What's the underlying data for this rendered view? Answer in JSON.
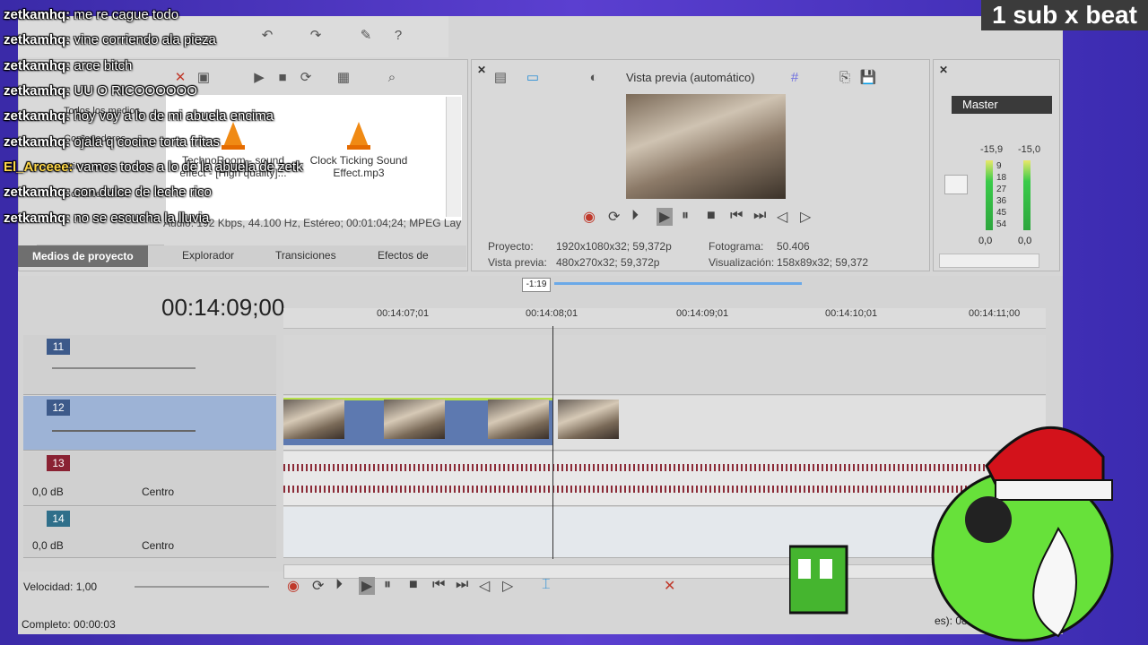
{
  "overlay": {
    "badge": "1 sub x beat",
    "chat": [
      {
        "user": "zetkamhq:",
        "msg": "me re cague todo"
      },
      {
        "user": "zetkamhq:",
        "msg": "vine corriendo ala pieza"
      },
      {
        "user": "zetkamhq:",
        "msg": "arce bitch"
      },
      {
        "user": "zetkamhq:",
        "msg": "UU O RICOOOOOO"
      },
      {
        "user": "zetkamhq:",
        "msg": "hoy voy a lo de mi abuela encima"
      },
      {
        "user": "zetkamhq:",
        "msg": "ojala q cocine torta fritas"
      },
      {
        "user": "El_Arceee:",
        "msg": "vamos todos a lo de la abuela de zetk"
      },
      {
        "user": "zetkamhq:",
        "msg": "con dulce de leche rico"
      },
      {
        "user": "zetkamhq:",
        "msg": "no se escucha la lluvia"
      }
    ]
  },
  "explorer": {
    "tree": [
      "Todos los medios",
      "Contenedores",
      "Etiquetas",
      "Contenedores"
    ],
    "media": [
      {
        "name": "TechnoRoom - sound effect - [High quality]...",
        "icon": "vlc-cone-icon"
      },
      {
        "name": "Clock Ticking Sound Effect.mp3",
        "icon": "vlc-cone-icon"
      }
    ],
    "status": "Audio: 192 Kbps, 44.100 Hz, Estéreo; 00:01:04;24; MPEG Lay",
    "tabs": [
      "Medios de proyecto",
      "Explorador",
      "Transiciones",
      "Efectos de"
    ]
  },
  "preview": {
    "mode": "Vista previa (automático)",
    "project_label": "Proyecto:",
    "project_value": "1920x1080x32; 59,372p",
    "preview_label": "Vista previa:",
    "preview_value": "480x270x32; 59,372p",
    "frame_label": "Fotograma:",
    "frame_value": "50.406",
    "display_label": "Visualización:",
    "display_value": "158x89x32; 59,372"
  },
  "master": {
    "title": "Master",
    "level_left": "-15,9",
    "level_right": "-15,0",
    "scale": [
      "9",
      "18",
      "27",
      "36",
      "45",
      "54"
    ],
    "bottom_left": "0,0",
    "bottom_right": "0,0"
  },
  "timeline": {
    "timecode": "00:14:09;00",
    "marker_label": "-1:19",
    "ticks": [
      "00:14:07;01",
      "00:14:08;01",
      "00:14:09;01",
      "00:14:10;01",
      "00:14:11;00"
    ],
    "tracks": [
      {
        "num": "11",
        "kind": "video",
        "color": "#3d5a8a"
      },
      {
        "num": "12",
        "kind": "video",
        "color": "#3d5a8a"
      },
      {
        "num": "13",
        "kind": "audio",
        "color": "#8a2233",
        "db": "0,0 dB",
        "pan": "Centro"
      },
      {
        "num": "14",
        "kind": "audio",
        "color": "#2f6f8a",
        "db": "0,0 dB",
        "pan": "Centro"
      }
    ],
    "speed": "Velocidad: 1,00",
    "complete": "Completo: 00:00:03",
    "status_right": "es): 08:"
  }
}
